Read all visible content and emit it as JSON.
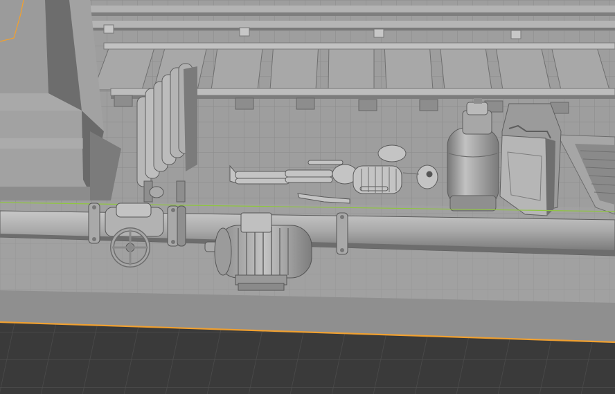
{
  "viewport": {
    "mode": "solid-shading",
    "objects": [
      {
        "name": "stone-pillar",
        "icon": "pillar-icon"
      },
      {
        "name": "rail-track",
        "icon": "rail-icon"
      },
      {
        "name": "cast-iron-radiator",
        "icon": "radiator-icon"
      },
      {
        "name": "skeleton",
        "icon": "skeleton-icon"
      },
      {
        "name": "gas-cylinder",
        "icon": "gas-cylinder-icon"
      },
      {
        "name": "jerry-can",
        "icon": "jerry-can-icon"
      },
      {
        "name": "drain-grate",
        "icon": "grate-icon"
      },
      {
        "name": "pipeline",
        "icon": "pipe-icon"
      },
      {
        "name": "gate-valve",
        "icon": "valve-icon"
      },
      {
        "name": "electric-motor",
        "icon": "motor-icon"
      }
    ],
    "overlays": {
      "x_axis_color": "#8fc63f",
      "selection_outline_color": "#f0a030"
    },
    "colors": {
      "floor": "#9c9c9c",
      "floor_grid": "#8a8a8a",
      "void": "#3c3c3c",
      "void_grid": "#4a4a4a",
      "mesh_light": "#b9b9b9",
      "mesh_mid": "#a3a3a3",
      "mesh_dark": "#6e6e6e"
    }
  }
}
